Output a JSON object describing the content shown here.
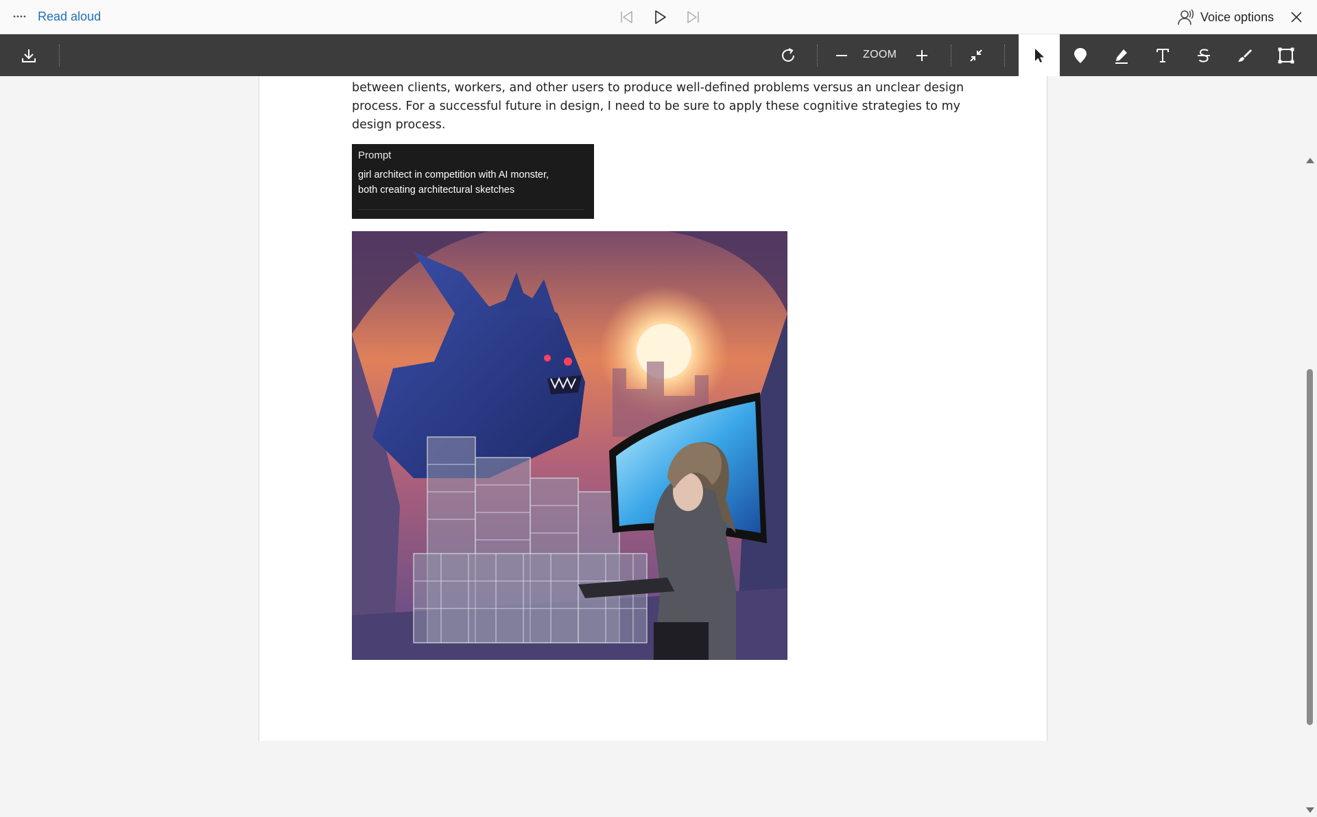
{
  "read_aloud": {
    "label": "Read aloud",
    "voice_options_label": "Voice options",
    "more_icon": "more-dots-icon",
    "controls": [
      "previous-icon",
      "play-icon",
      "next-icon"
    ]
  },
  "toolbar": {
    "zoom_label": "ZOOM",
    "tools": [
      "download-icon",
      "rotate-icon",
      "zoom-out-icon",
      "zoom-in-icon",
      "fit-page-icon",
      "select-icon",
      "pin-icon",
      "highlight-icon",
      "text-icon",
      "strikethrough-icon",
      "draw-icon",
      "crop-icon"
    ],
    "active_tool": "select"
  },
  "document": {
    "paragraph_lines": [
      "between clients, workers, and other users to produce well-defined problems versus an unclear design",
      "process. For a successful future in design, I need to be sure to apply these cognitive strategies to my",
      "design process."
    ],
    "prompt": {
      "title": "Prompt",
      "lines": [
        "girl architect in competition with AI monster,",
        "both creating architectural sketches"
      ]
    },
    "image": "ai-generated-illustration"
  },
  "colors": {
    "toolbar_bg": "#3c3c3c",
    "accent_link": "#1f6fb5",
    "prompt_bg": "#1b1b1b"
  }
}
